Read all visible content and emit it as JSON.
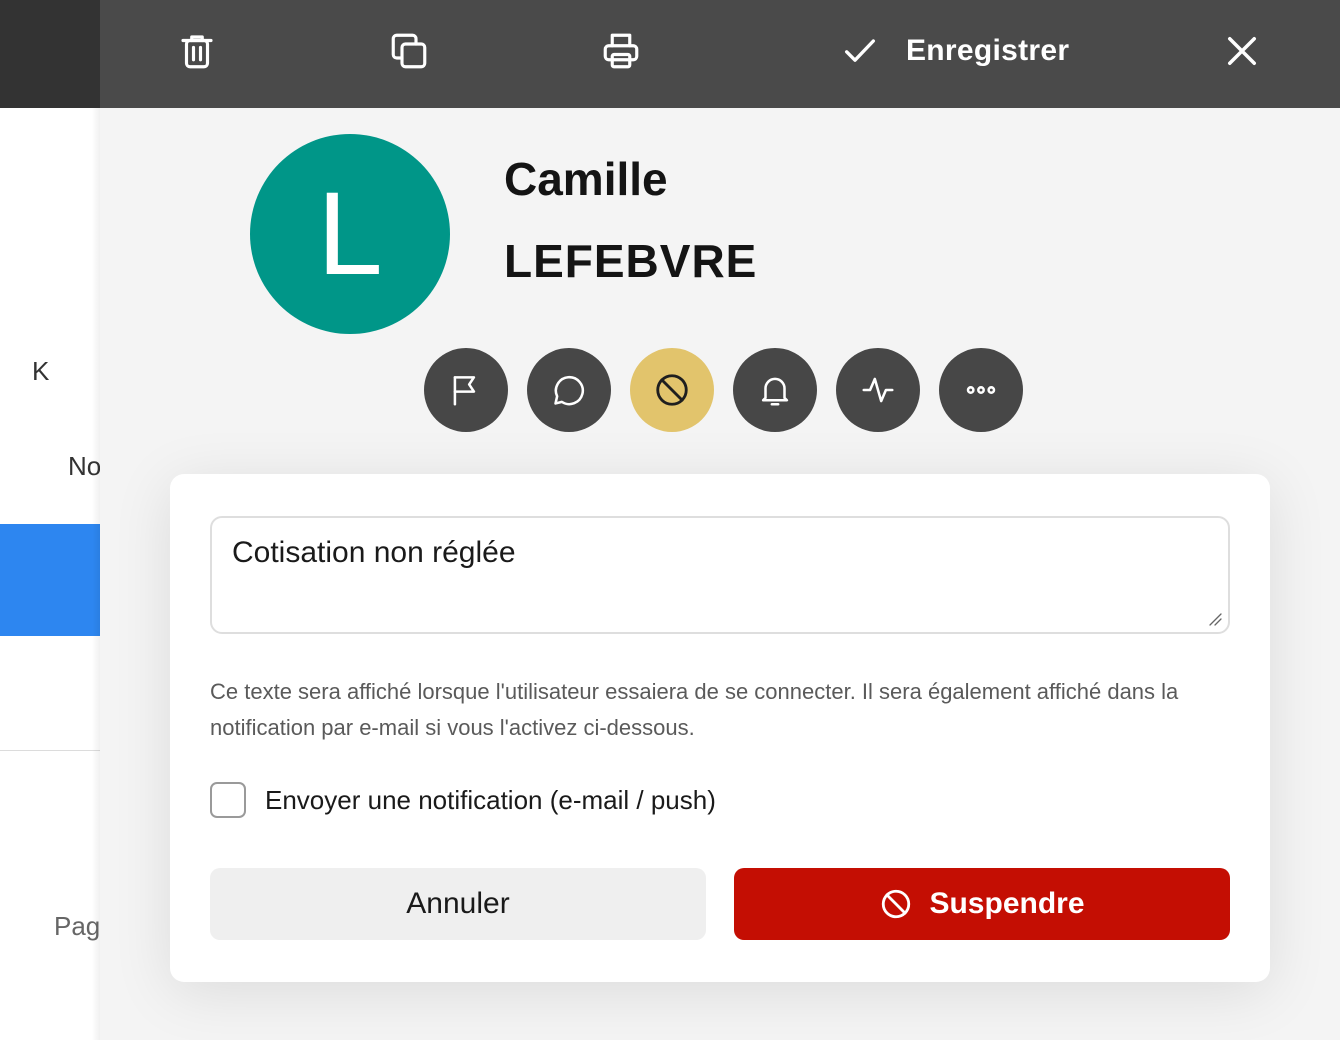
{
  "background": {
    "letters": {
      "k": "K",
      "no": "No",
      "pag": "Pag"
    },
    "highlight_color": "#2d86f0"
  },
  "toolbar": {
    "delete_icon": "trash-icon",
    "duplicate_icon": "copy-icon",
    "print_icon": "printer-icon",
    "save_label": "Enregistrer",
    "close_icon": "close-icon",
    "background_color": "#4a4a4a"
  },
  "profile": {
    "avatar_initial": "L",
    "avatar_color": "#009688",
    "first_name": "Camille",
    "last_name": "LEFEBVRE"
  },
  "action_buttons": [
    {
      "icon": "flag-icon",
      "active": false
    },
    {
      "icon": "chat-bubble-icon",
      "active": false
    },
    {
      "icon": "block-icon",
      "active": true
    },
    {
      "icon": "bell-icon",
      "active": false
    },
    {
      "icon": "activity-icon",
      "active": false
    },
    {
      "icon": "more-icon",
      "active": false
    }
  ],
  "suspend_dialog": {
    "reason_value": "Cotisation non réglée",
    "help_text": "Ce texte sera affiché lorsque l'utilisateur essaiera de se connecter. Il sera également affiché dans la notification par e-mail si vous l'activez ci-dessous.",
    "notify_label": "Envoyer une notification (e-mail / push)",
    "notify_checked": false,
    "cancel_label": "Annuler",
    "suspend_label": "Suspendre",
    "suspend_color": "#c40e03"
  }
}
